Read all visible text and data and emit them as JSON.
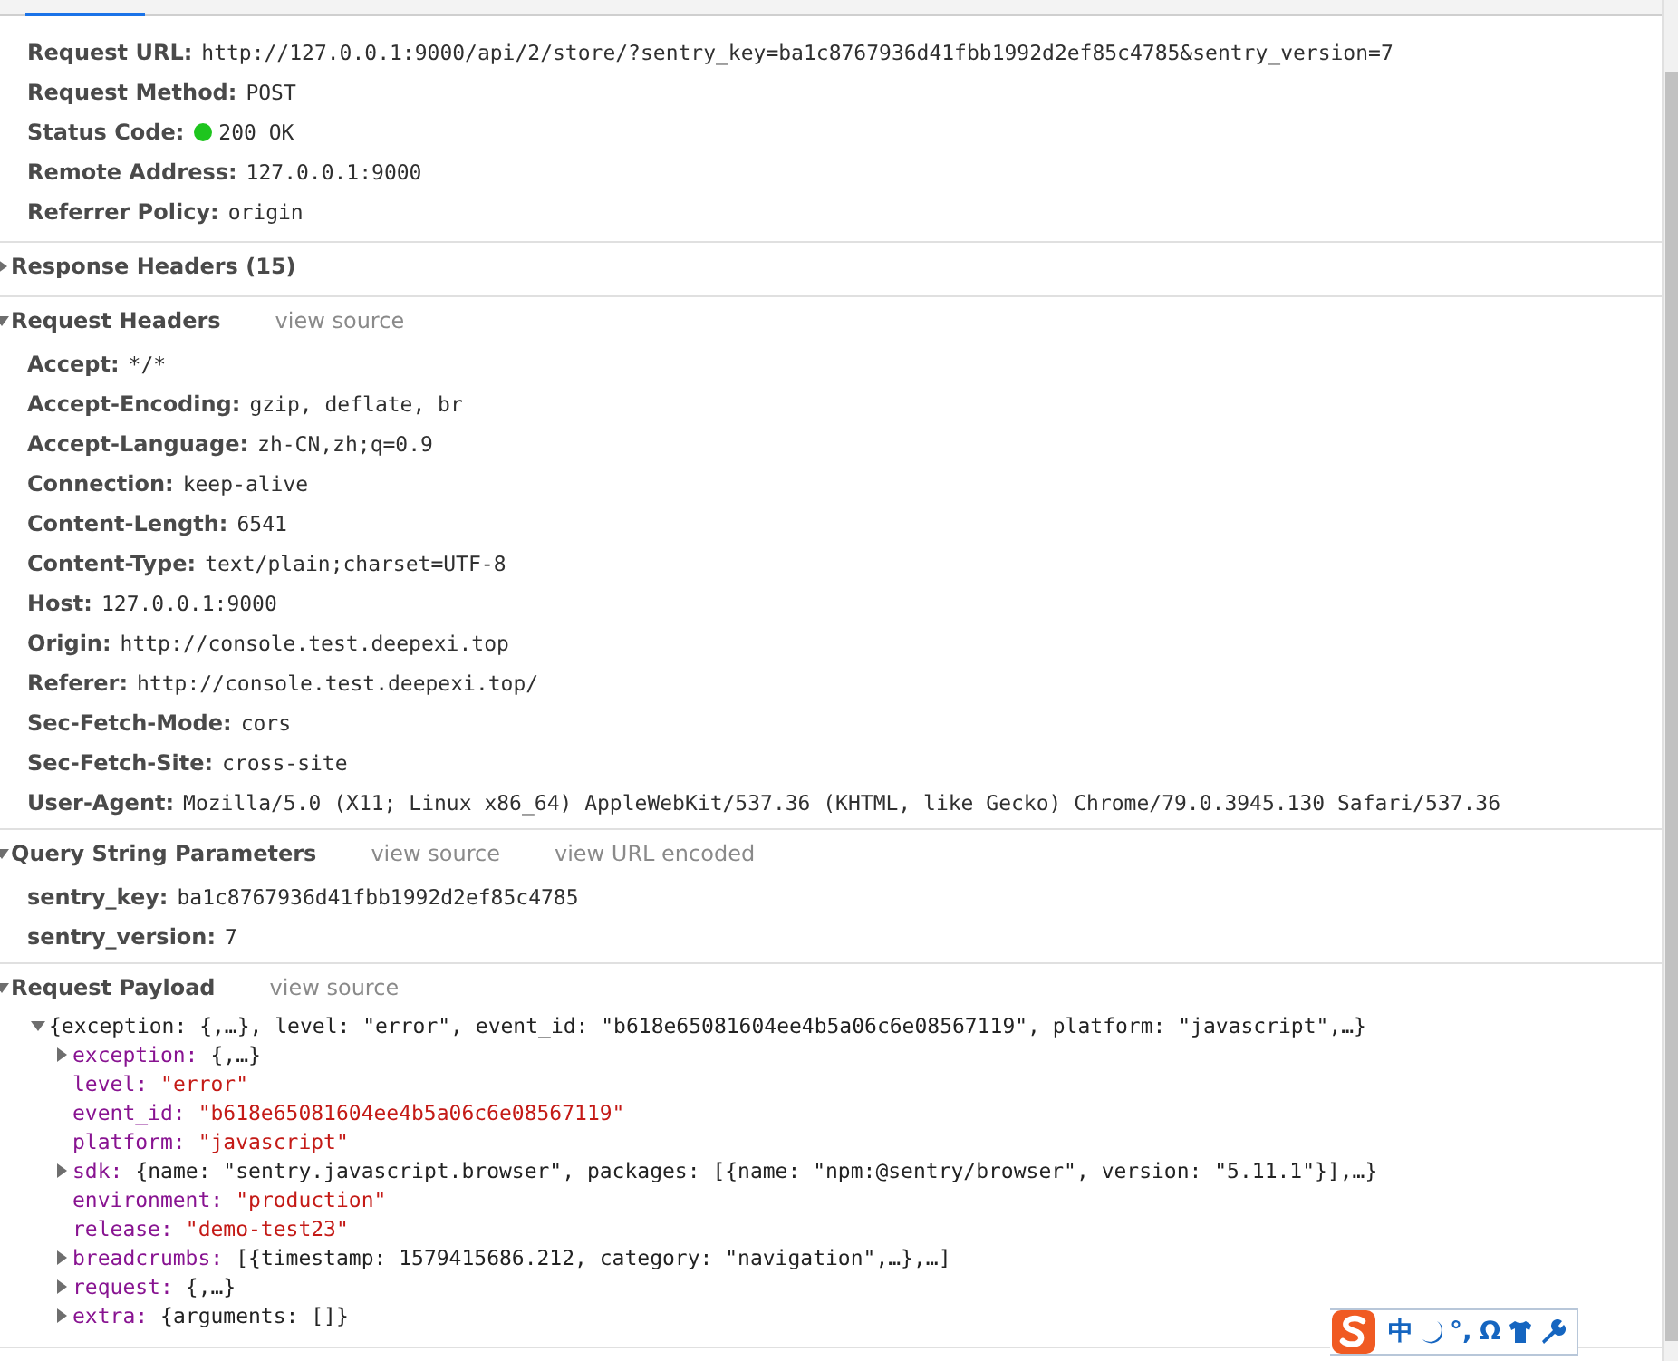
{
  "general": {
    "rows": [
      {
        "label": "Request URL:",
        "value": "http://127.0.0.1:9000/api/2/store/?sentry_key=ba1c8767936d41fbb1992d2ef85c4785&sentry_version=7",
        "status_dot": false
      },
      {
        "label": "Request Method:",
        "value": "POST",
        "status_dot": false
      },
      {
        "label": "Status Code:",
        "value": "200 OK",
        "status_dot": true
      },
      {
        "label": "Remote Address:",
        "value": "127.0.0.1:9000",
        "status_dot": false
      },
      {
        "label": "Referrer Policy:",
        "value": "origin",
        "status_dot": false
      }
    ]
  },
  "sections": [
    {
      "title": "Response Headers (15)",
      "expanded": false
    },
    {
      "title": "Request Headers",
      "expanded": true,
      "links": [
        "view source"
      ],
      "rows": [
        {
          "label": "Accept:",
          "value": "*/*"
        },
        {
          "label": "Accept-Encoding:",
          "value": "gzip, deflate, br"
        },
        {
          "label": "Accept-Language:",
          "value": "zh-CN,zh;q=0.9"
        },
        {
          "label": "Connection:",
          "value": "keep-alive"
        },
        {
          "label": "Content-Length:",
          "value": "6541"
        },
        {
          "label": "Content-Type:",
          "value": "text/plain;charset=UTF-8"
        },
        {
          "label": "Host:",
          "value": "127.0.0.1:9000"
        },
        {
          "label": "Origin:",
          "value": "http://console.test.deepexi.top"
        },
        {
          "label": "Referer:",
          "value": "http://console.test.deepexi.top/"
        },
        {
          "label": "Sec-Fetch-Mode:",
          "value": "cors"
        },
        {
          "label": "Sec-Fetch-Site:",
          "value": "cross-site"
        },
        {
          "label": "User-Agent:",
          "value": "Mozilla/5.0 (X11; Linux x86_64) AppleWebKit/537.36 (KHTML, like Gecko) Chrome/79.0.3945.130 Safari/537.36"
        }
      ]
    },
    {
      "title": "Query String Parameters",
      "expanded": true,
      "links": [
        "view source",
        "view URL encoded"
      ],
      "rows": [
        {
          "label": "sentry_key:",
          "value": "ba1c8767936d41fbb1992d2ef85c4785"
        },
        {
          "label": "sentry_version:",
          "value": "7"
        }
      ]
    }
  ],
  "payload": {
    "title": "Request Payload",
    "expanded": true,
    "links": [
      "view source"
    ],
    "root": {
      "summary": "{exception: {,…}, level: \"error\", event_id: \"b618e65081604ee4b5a06c6e08567119\", platform: \"javascript\",…}",
      "expanded": true,
      "children": [
        {
          "key": "exception:",
          "value": "{,…}",
          "kind": "object"
        },
        {
          "key": "level:",
          "value": "\"error\"",
          "kind": "string"
        },
        {
          "key": "event_id:",
          "value": "\"b618e65081604ee4b5a06c6e08567119\"",
          "kind": "string"
        },
        {
          "key": "platform:",
          "value": "\"javascript\"",
          "kind": "string"
        },
        {
          "key": "sdk:",
          "value": "{name: \"sentry.javascript.browser\", packages: [{name: \"npm:@sentry/browser\", version: \"5.11.1\"}],…}",
          "kind": "object"
        },
        {
          "key": "environment:",
          "value": "\"production\"",
          "kind": "string"
        },
        {
          "key": "release:",
          "value": "\"demo-test23\"",
          "kind": "string"
        },
        {
          "key": "breadcrumbs:",
          "value": "[{timestamp: 1579415686.212, category: \"navigation\",…},…]",
          "kind": "object"
        },
        {
          "key": "request:",
          "value": "{,…}",
          "kind": "object"
        },
        {
          "key": "extra:",
          "value": "{arguments: []}",
          "kind": "object"
        }
      ]
    }
  },
  "ime_toolbar": {
    "texts": [
      "中",
      "°,",
      "Ω"
    ]
  }
}
